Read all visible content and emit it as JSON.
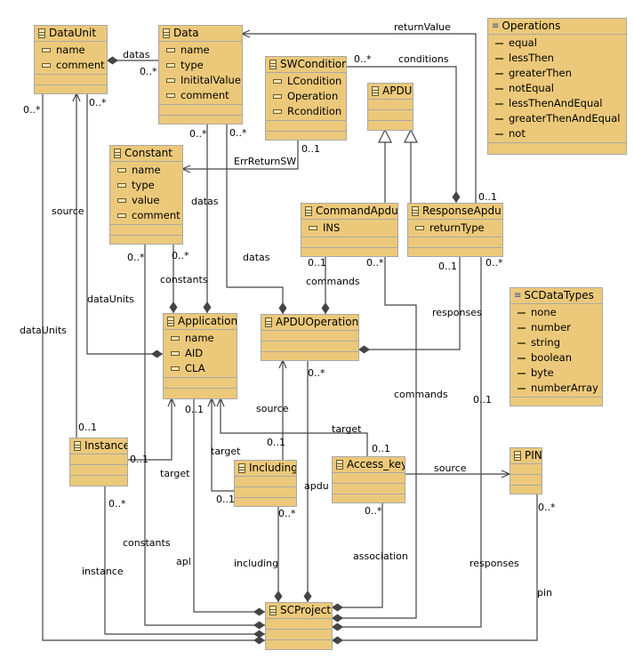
{
  "classes": [
    {
      "id": "DataUnit",
      "name": "DataUnit",
      "kind": "class",
      "attributes": [
        "name",
        "comment"
      ]
    },
    {
      "id": "Data",
      "name": "Data",
      "kind": "class",
      "attributes": [
        "name",
        "type",
        "InititalValue",
        "comment"
      ]
    },
    {
      "id": "SWCondition",
      "name": "SWCondition",
      "kind": "class",
      "attributes": [
        "LCondition",
        "Operation",
        "Rcondition"
      ]
    },
    {
      "id": "APDU",
      "name": "APDU",
      "kind": "class",
      "attributes": []
    },
    {
      "id": "Operations",
      "name": "Operations",
      "kind": "enum",
      "attributes": [
        "equal",
        "lessThen",
        "greaterThen",
        "notEqual",
        "lessThenAndEqual",
        "greaterThenAndEqual",
        "not"
      ]
    },
    {
      "id": "Constant",
      "name": "Constant",
      "kind": "class",
      "attributes": [
        "name",
        "type",
        "value",
        "comment"
      ]
    },
    {
      "id": "CommandApdu",
      "name": "CommandApdu",
      "kind": "class",
      "attributes": [
        "INS"
      ]
    },
    {
      "id": "ResponseApdu",
      "name": "ResponseApdu",
      "kind": "class",
      "attributes": [
        "returnType"
      ]
    },
    {
      "id": "SCDataTypes",
      "name": "SCDataTypes",
      "kind": "enum",
      "attributes": [
        "none",
        "number",
        "string",
        "boolean",
        "byte",
        "numberArray"
      ]
    },
    {
      "id": "Application",
      "name": "Application",
      "kind": "class",
      "attributes": [
        "name",
        "AID",
        "CLA"
      ]
    },
    {
      "id": "APDUOperation",
      "name": "APDUOperation",
      "kind": "class",
      "attributes": []
    },
    {
      "id": "Instance",
      "name": "Instance",
      "kind": "class",
      "attributes": []
    },
    {
      "id": "Including",
      "name": "Including",
      "kind": "class",
      "attributes": []
    },
    {
      "id": "Access_key",
      "name": "Access_key",
      "kind": "class",
      "attributes": []
    },
    {
      "id": "PIN",
      "name": "PIN",
      "kind": "class",
      "attributes": []
    },
    {
      "id": "SCProject",
      "name": "SCProject",
      "kind": "class",
      "attributes": []
    }
  ],
  "edges": [
    {
      "from": "DataUnit",
      "to": "Data",
      "type": "composition",
      "labels": [
        "datas",
        "0..*"
      ]
    },
    {
      "from": "ResponseApdu",
      "to": "Data",
      "type": "association",
      "labels": [
        "returnValue",
        "0..1"
      ]
    },
    {
      "from": "ResponseApdu",
      "to": "SWCondition",
      "type": "composition",
      "labels": [
        "0..*",
        "conditions"
      ]
    },
    {
      "from": "SWCondition",
      "to": "Constant",
      "type": "association",
      "labels": [
        "0..1",
        "ErrReturnSW"
      ]
    },
    {
      "from": "CommandApdu",
      "to": "APDU",
      "type": "generalization",
      "labels": []
    },
    {
      "from": "ResponseApdu",
      "to": "APDU",
      "type": "generalization",
      "labels": []
    },
    {
      "from": "Instance",
      "to": "DataUnit",
      "type": "association",
      "labels": [
        "source",
        "0..1"
      ]
    },
    {
      "from": "Application",
      "to": "DataUnit",
      "type": "composition",
      "labels": [
        "0..*",
        "dataUnits"
      ]
    },
    {
      "from": "SCProject",
      "to": "DataUnit",
      "type": "composition",
      "labels": [
        "0..*",
        "dataUnits"
      ]
    },
    {
      "from": "Application",
      "to": "Data",
      "type": "composition",
      "labels": [
        "0..*",
        "datas"
      ]
    },
    {
      "from": "APDUOperation",
      "to": "Data",
      "type": "composition",
      "labels": [
        "0..*",
        "datas"
      ]
    },
    {
      "from": "Application",
      "to": "Constant",
      "type": "composition",
      "labels": [
        "0..*",
        "constants"
      ]
    },
    {
      "from": "SCProject",
      "to": "Constant",
      "type": "composition",
      "labels": [
        "0..*",
        "constants"
      ]
    },
    {
      "from": "APDUOperation",
      "to": "CommandApdu",
      "type": "composition",
      "labels": [
        "0..1",
        "commands"
      ]
    },
    {
      "from": "SCProject",
      "to": "CommandApdu",
      "type": "composition",
      "labels": [
        "0..*",
        "commands"
      ]
    },
    {
      "from": "APDUOperation",
      "to": "ResponseApdu",
      "type": "composition",
      "labels": [
        "0..1",
        "responses"
      ]
    },
    {
      "from": "SCProject",
      "to": "ResponseApdu",
      "type": "composition",
      "labels": [
        "0..*",
        "0..1",
        "responses"
      ]
    },
    {
      "from": "Instance",
      "to": "Application",
      "type": "association",
      "labels": [
        "0..1",
        "target"
      ]
    },
    {
      "from": "Including",
      "to": "APDUOperation",
      "type": "association",
      "labels": [
        "source",
        "0..1"
      ]
    },
    {
      "from": "Including",
      "to": "Application",
      "type": "association",
      "labels": [
        "target",
        "0..1"
      ]
    },
    {
      "from": "Access_key",
      "to": "Application",
      "type": "association",
      "labels": [
        "target",
        "0..1"
      ]
    },
    {
      "from": "SCProject",
      "to": "APDUOperation",
      "type": "composition",
      "labels": [
        "0..*",
        "apdu"
      ]
    },
    {
      "from": "Access_key",
      "to": "PIN",
      "type": "association",
      "labels": [
        "source"
      ]
    },
    {
      "from": "SCProject",
      "to": "Access_key",
      "type": "composition",
      "labels": [
        "0..*",
        "association"
      ]
    },
    {
      "from": "SCProject",
      "to": "Including",
      "type": "composition",
      "labels": [
        "0..*",
        "including"
      ]
    },
    {
      "from": "SCProject",
      "to": "Application",
      "type": "composition",
      "labels": [
        "0..1",
        "apl"
      ]
    },
    {
      "from": "SCProject",
      "to": "Instance",
      "type": "composition",
      "labels": [
        "0..*",
        "instance"
      ]
    },
    {
      "from": "SCProject",
      "to": "PIN",
      "type": "composition",
      "labels": [
        "0..*",
        "pin"
      ]
    }
  ],
  "colors": {
    "class_fill": "#ecc97a",
    "border": "#a8a8a8",
    "line": "#444444",
    "enum_icon": "#2a4ea0"
  }
}
